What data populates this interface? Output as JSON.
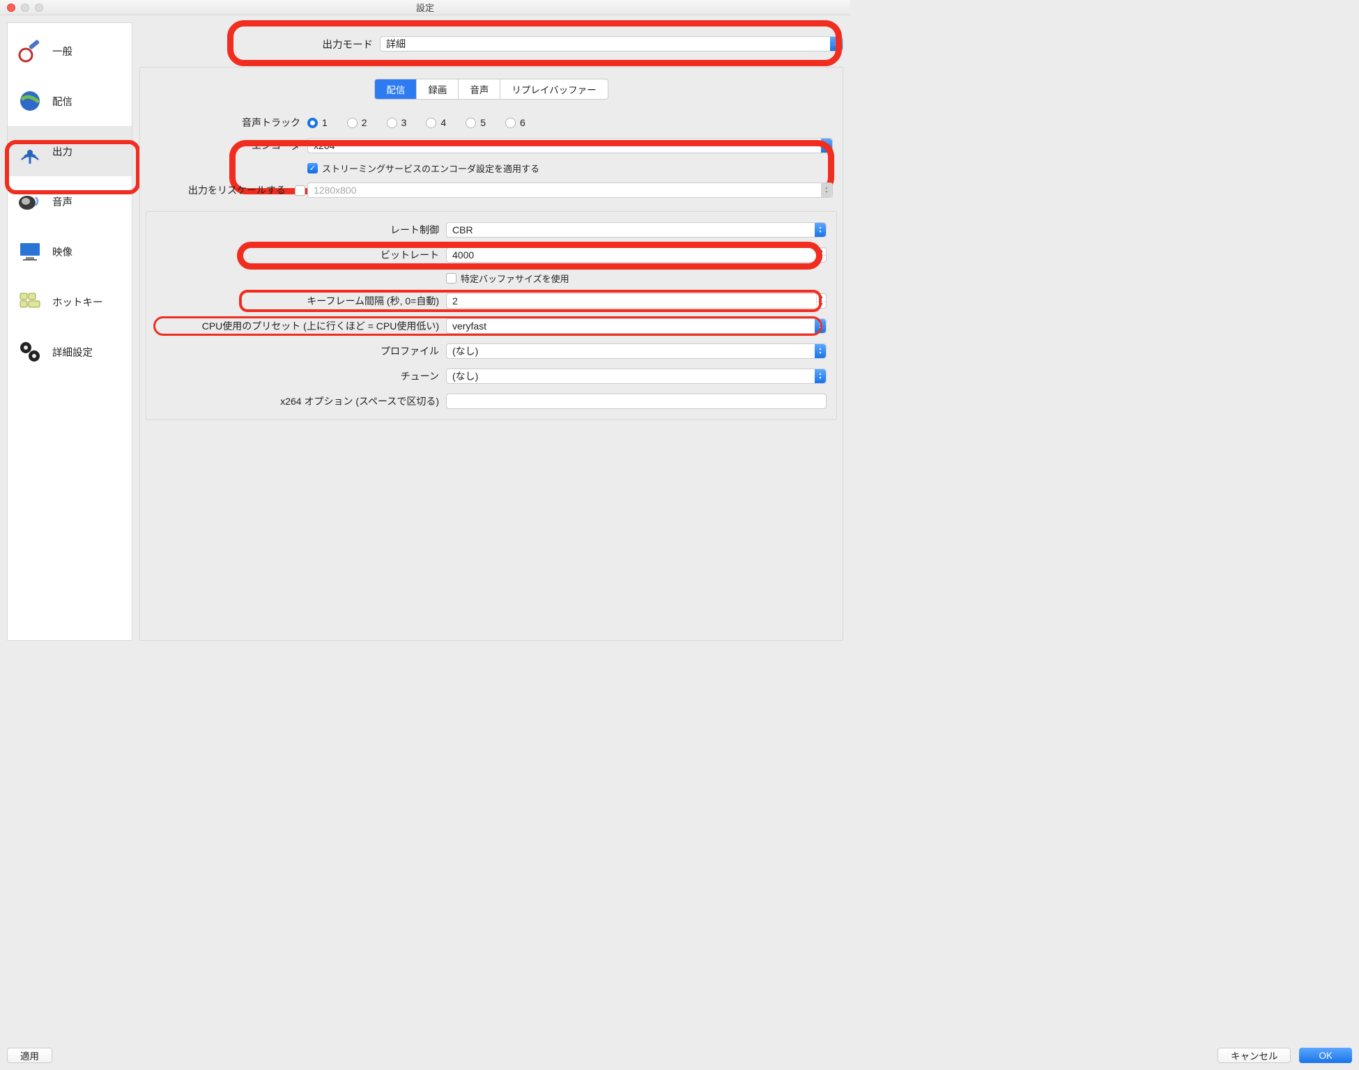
{
  "window_title": "設定",
  "sidebar": {
    "items": [
      {
        "label": "一般"
      },
      {
        "label": "配信"
      },
      {
        "label": "出力"
      },
      {
        "label": "音声"
      },
      {
        "label": "映像"
      },
      {
        "label": "ホットキー"
      },
      {
        "label": "詳細設定"
      }
    ]
  },
  "output_mode": {
    "label": "出力モード",
    "value": "詳細"
  },
  "tabs": {
    "streaming": "配信",
    "recording": "録画",
    "audio": "音声",
    "replay": "リプレイバッファー"
  },
  "audio_track_label": "音声トラック",
  "audio_tracks": [
    "1",
    "2",
    "3",
    "4",
    "5",
    "6"
  ],
  "encoder": {
    "label": "エンコーダ",
    "value": "x264"
  },
  "apply_service": "ストリーミングサービスのエンコーダ設定を適用する",
  "rescale": {
    "label": "出力をリスケールする",
    "placeholder": "1280x800"
  },
  "rate_control": {
    "label": "レート制御",
    "value": "CBR"
  },
  "bitrate": {
    "label": "ビットレート",
    "value": "4000"
  },
  "custom_buffer": "特定バッファサイズを使用",
  "keyframe": {
    "label": "キーフレーム間隔 (秒, 0=自動)",
    "value": "2"
  },
  "cpu_preset": {
    "label": "CPU使用のプリセット (上に行くほど = CPU使用低い)",
    "value": "veryfast"
  },
  "profile": {
    "label": "プロファイル",
    "value": "(なし)"
  },
  "tune": {
    "label": "チューン",
    "value": "(なし)"
  },
  "x264_opts": {
    "label": "x264 オプション (スペースで区切る)",
    "value": ""
  },
  "buttons": {
    "apply": "適用",
    "cancel": "キャンセル",
    "ok": "OK"
  }
}
